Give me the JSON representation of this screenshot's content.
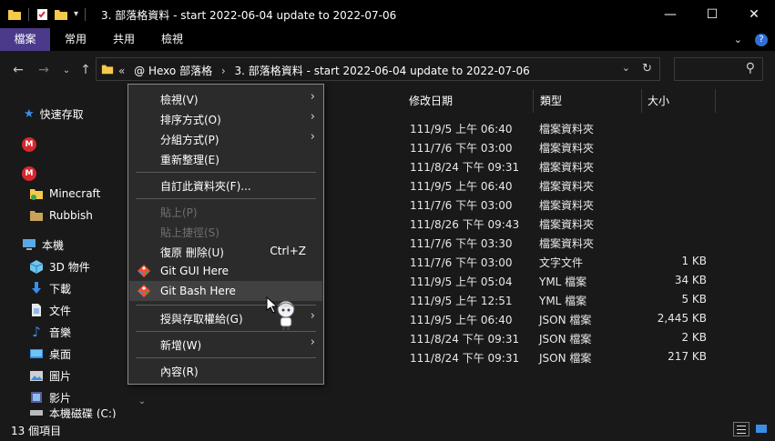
{
  "window": {
    "title": "3. 部落格資料 - start 2022-06-04 update to 2022-07-06",
    "minimize_glyph": "—",
    "maximize_glyph": "☐",
    "close_glyph": "✕"
  },
  "ribbon": {
    "tabs": [
      "檔案",
      "常用",
      "共用",
      "檢視"
    ],
    "help_glyph": "?",
    "expand_glyph": "⌄"
  },
  "address": {
    "prefix": "«",
    "crumbs": [
      "@ Hexo 部落格",
      "3. 部落格資料 - start 2022-06-04 update to 2022-07-06"
    ],
    "separator": "›",
    "dropdown_glyph": "⌄",
    "refresh_glyph": "↻",
    "search_glyph": "⚲"
  },
  "nav": {
    "back_glyph": "←",
    "forward_glyph": "→",
    "recent_glyph": "⌄",
    "up_glyph": "↑",
    "items": [
      {
        "label": "快速存取",
        "icon": "star-icon"
      },
      {
        "label": "",
        "icon": "mega-icon"
      },
      {
        "label": "",
        "icon": "mega-icon"
      },
      {
        "label": "Minecraft",
        "icon": "folder-icon"
      },
      {
        "label": "Rubbish",
        "icon": "folder-icon"
      },
      {
        "label": "本機",
        "icon": "computer-icon"
      },
      {
        "label": "3D 物件",
        "icon": "cube-icon"
      },
      {
        "label": "下載",
        "icon": "download-icon"
      },
      {
        "label": "文件",
        "icon": "document-icon"
      },
      {
        "label": "音樂",
        "icon": "music-icon"
      },
      {
        "label": "桌面",
        "icon": "desktop-icon"
      },
      {
        "label": "圖片",
        "icon": "pictures-icon"
      },
      {
        "label": "影片",
        "icon": "video-icon"
      },
      {
        "label": "本機磁碟 (C:)",
        "icon": "drive-icon"
      }
    ],
    "scroll_down_glyph": "⌄"
  },
  "columns": {
    "date": "修改日期",
    "type": "類型",
    "size": "大小"
  },
  "rows": [
    {
      "date": "111/9/5 上午 06:40",
      "type": "檔案資料夾",
      "size": ""
    },
    {
      "date": "111/7/6 下午 03:00",
      "type": "檔案資料夾",
      "size": ""
    },
    {
      "date": "111/8/24 下午 09:31",
      "type": "檔案資料夾",
      "size": ""
    },
    {
      "date": "111/9/5 上午 06:40",
      "type": "檔案資料夾",
      "size": ""
    },
    {
      "date": "111/7/6 下午 03:00",
      "type": "檔案資料夾",
      "size": ""
    },
    {
      "date": "111/8/26 下午 09:43",
      "type": "檔案資料夾",
      "size": ""
    },
    {
      "date": "111/7/6 下午 03:30",
      "type": "檔案資料夾",
      "size": ""
    },
    {
      "date": "111/7/6 下午 03:00",
      "type": "文字文件",
      "size": "1 KB"
    },
    {
      "date": "111/9/5 上午 05:04",
      "type": "YML 檔案",
      "size": "34 KB"
    },
    {
      "date": "111/9/5 上午 12:51",
      "type": "YML 檔案",
      "size": "5 KB"
    },
    {
      "date": "111/9/5 上午 06:40",
      "type": "JSON 檔案",
      "size": "2,445 KB"
    },
    {
      "date": "111/8/24 下午 09:31",
      "type": "JSON 檔案",
      "size": "2 KB"
    },
    {
      "date": "111/8/24 下午 09:31",
      "type": "JSON 檔案",
      "size": "217 KB"
    }
  ],
  "context_menu": {
    "items": [
      {
        "label": "檢視(V)",
        "submenu": true
      },
      {
        "label": "排序方式(O)",
        "submenu": true
      },
      {
        "label": "分組方式(P)",
        "submenu": true
      },
      {
        "label": "重新整理(E)"
      },
      {
        "label": "自訂此資料夾(F)..."
      },
      {
        "label": "貼上(P)",
        "disabled": true
      },
      {
        "label": "貼上捷徑(S)",
        "disabled": true
      },
      {
        "label": "復原 刪除(U)",
        "shortcut": "Ctrl+Z"
      },
      {
        "label": "Git GUI Here",
        "icon": "git-gui-icon"
      },
      {
        "label": "Git Bash Here",
        "icon": "git-bash-icon",
        "highlighted": true
      },
      {
        "label": "授與存取權給(G)",
        "submenu": true
      },
      {
        "label": "新增(W)",
        "submenu": true
      },
      {
        "label": "內容(R)"
      }
    ],
    "submenu_glyph": "›"
  },
  "status": {
    "item_count": "13 個項目"
  },
  "colors": {
    "file_tab": "#4b3a8a",
    "background": "#191919",
    "menu_bg": "#2b2b2b",
    "menu_hover": "#414141",
    "disabled": "#6f6f6f",
    "folder": "#f6c94a",
    "quick_access_star": "#3a8ee6",
    "mega": "#d9272e",
    "git_orange": "#f05033"
  }
}
